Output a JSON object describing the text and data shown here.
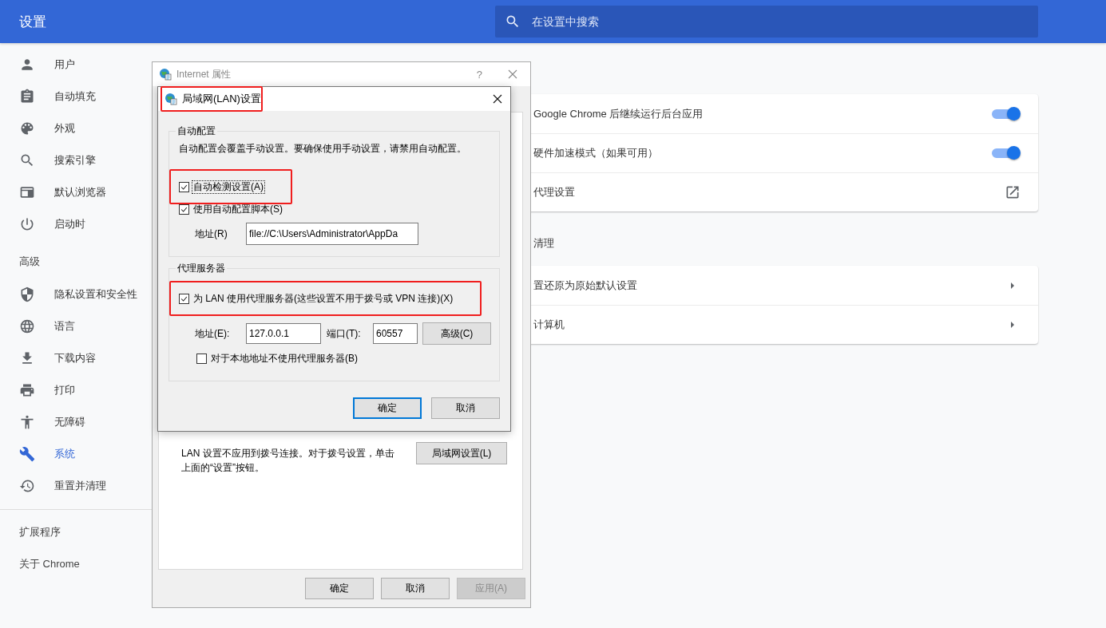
{
  "header": {
    "title": "设置",
    "search": {
      "placeholder": "在设置中搜索"
    }
  },
  "sidebar": {
    "main_items": [
      {
        "label": "用户",
        "selected": false
      },
      {
        "label": "自动填充",
        "selected": false
      },
      {
        "label": "外观",
        "selected": false
      },
      {
        "label": "搜索引擎",
        "selected": false
      },
      {
        "label": "默认浏览器",
        "selected": false
      },
      {
        "label": "启动时",
        "selected": false
      }
    ],
    "advanced_heading": "高级",
    "advanced_items": [
      {
        "label": "隐私设置和安全性",
        "selected": false
      },
      {
        "label": "语言",
        "selected": false
      },
      {
        "label": "下载内容",
        "selected": false
      },
      {
        "label": "打印",
        "selected": false
      },
      {
        "label": "无障碍",
        "selected": false
      },
      {
        "label": "系统",
        "selected": true
      },
      {
        "label": "重置并清理",
        "selected": false
      }
    ],
    "footer_items": [
      "扩展程序",
      "关于 Chrome"
    ]
  },
  "sections": [
    {
      "rows": [
        {
          "label": "Google Chrome 后继续运行后台应用",
          "kind": "toggle",
          "on": true
        },
        {
          "label": "硬件加速模式（如果可用）",
          "kind": "toggle",
          "on": true
        },
        {
          "label": "代理设置",
          "kind": "external"
        }
      ]
    },
    {
      "heading": "清理",
      "rows": [
        {
          "label": "置还原为原始默认设置",
          "kind": "arrow"
        },
        {
          "label": "计算机",
          "kind": "arrow"
        }
      ]
    }
  ],
  "internet_properties": {
    "title": "Internet 属性",
    "help": "?",
    "lan_note": "LAN 设置不应用到拨号连接。对于拨号设置，单击上面的“设置”按钮。",
    "lan_button": "局域网设置(L)",
    "buttons": [
      {
        "label": "确定",
        "disabled": false
      },
      {
        "label": "取消",
        "disabled": false
      },
      {
        "label": "应用(A)",
        "disabled": true
      }
    ]
  },
  "lan_dialog": {
    "title": "局域网(LAN)设置",
    "title_highlighted": true,
    "auto_config": {
      "legend": "自动配置",
      "note": "自动配置会覆盖手动设置。要确保使用手动设置，请禁用自动配置。",
      "options": [
        {
          "label": "自动检测设置(A)",
          "checked": true,
          "highlighted": true,
          "focused": true
        },
        {
          "label": "使用自动配置脚本(S)",
          "checked": true,
          "highlighted": false,
          "focused": false
        }
      ],
      "address_label": "地址(R)",
      "address_value": "file://C:\\Users\\Administrator\\AppDa"
    },
    "proxy": {
      "legend": "代理服务器",
      "use_proxy": {
        "label": "为 LAN 使用代理服务器(这些设置不用于拨号或 VPN 连接)(X)",
        "checked": true,
        "highlighted": true
      },
      "address_label": "地址(E):",
      "address_value": "127.0.0.1",
      "port_label": "端口(T):",
      "port_value": "60557",
      "advanced_button": "高级(C)",
      "bypass_local": {
        "label": "对于本地地址不使用代理服务器(B)",
        "checked": false,
        "highlighted": false
      }
    },
    "buttons": [
      {
        "label": "确定",
        "default": true
      },
      {
        "label": "取消",
        "default": false
      }
    ]
  }
}
